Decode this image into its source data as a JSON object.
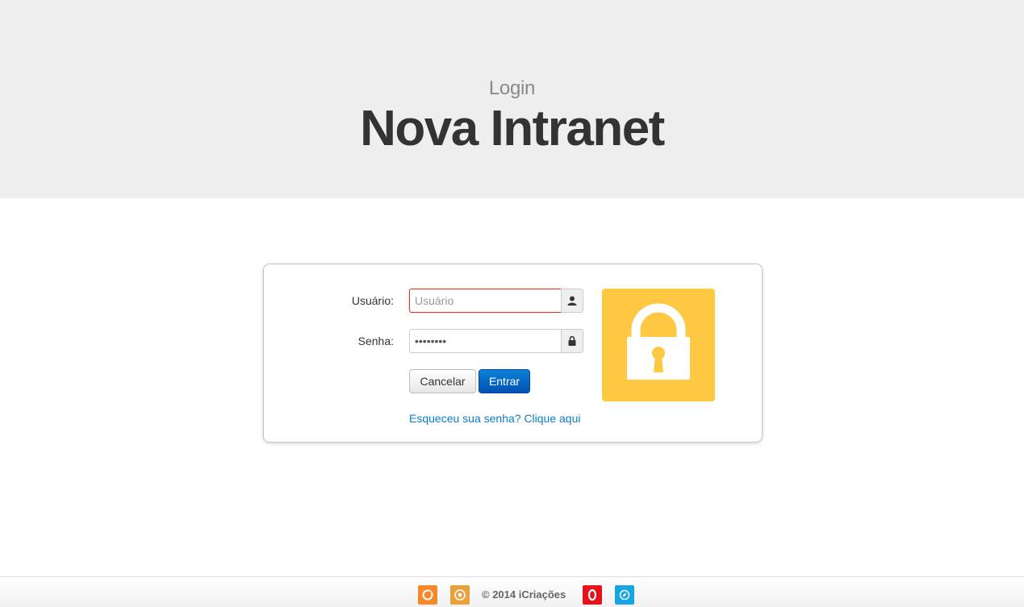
{
  "header": {
    "subtitle": "Login",
    "title": "Nova Intranet",
    "background_color": "#eeeeee"
  },
  "form": {
    "username_label": "Usuário:",
    "username_placeholder": "Usuário",
    "username_value": "",
    "username_state": "error",
    "username_icon": "user-icon",
    "password_label": "Senha:",
    "password_value": "********",
    "password_icon": "lock-icon",
    "cancel_label": "Cancelar",
    "submit_label": "Entrar",
    "forgot_link": "Esqueceu sua senha? Clique aqui",
    "lock_tile_color": "#ffc843",
    "lock_tile_icon": "padlock-icon"
  },
  "footer": {
    "copyright": "©  2014 iCriações",
    "browser_icons": [
      {
        "name": "firefox-icon",
        "color": "#f7892b"
      },
      {
        "name": "chrome-icon",
        "color": "#e8a13b"
      },
      {
        "name": "opera-icon",
        "color": "#e5131a"
      },
      {
        "name": "safari-icon",
        "color": "#19a5e0"
      }
    ]
  },
  "colors": {
    "primary_button": "#0a6fcf",
    "link": "#0a7dc9",
    "error_border": "#e0352b"
  }
}
